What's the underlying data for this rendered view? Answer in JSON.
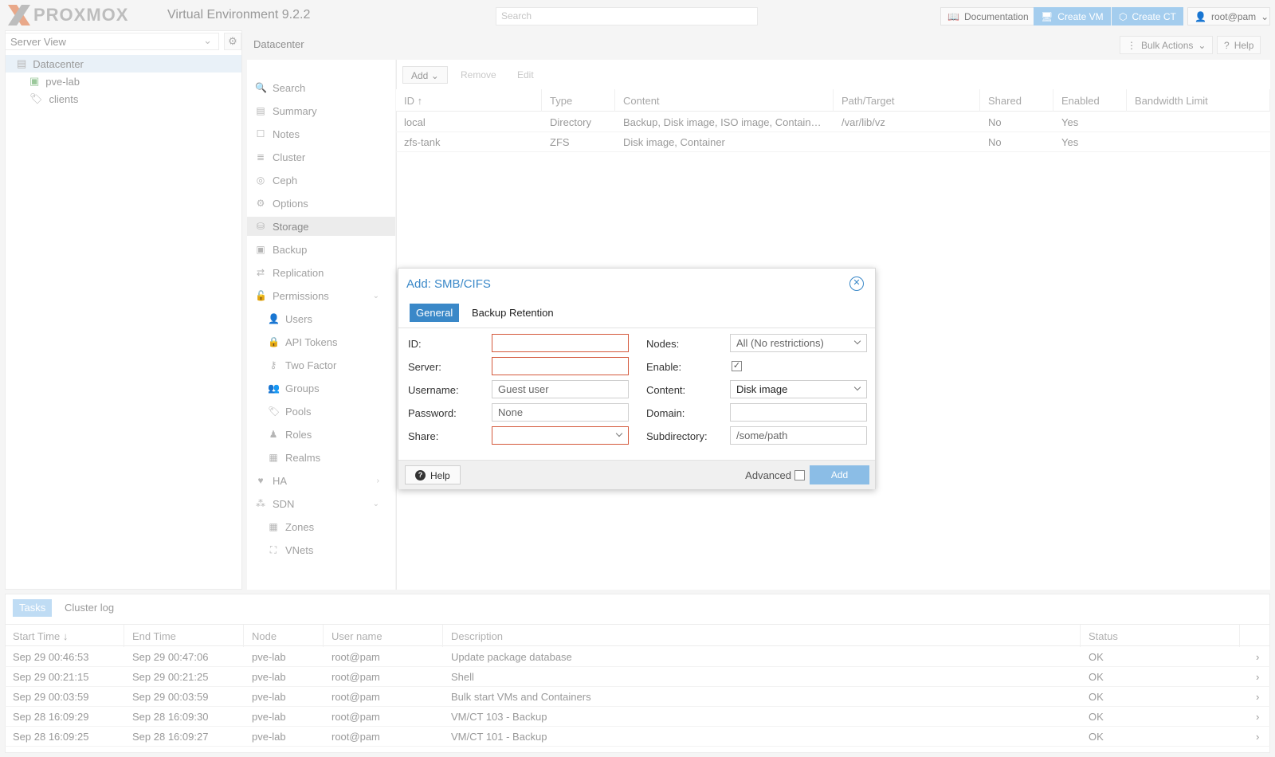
{
  "app": {
    "brand": "PROXMOX",
    "version_label": "Virtual Environment 9.2.2",
    "search_placeholder": "Search",
    "buttons": {
      "documentation": "Documentation",
      "create_vm": "Create VM",
      "create_ct": "Create CT",
      "user": "root@pam"
    }
  },
  "tree": {
    "view_label": "Server View",
    "items": [
      {
        "label": "Datacenter",
        "icon": "datacenter-icon"
      },
      {
        "label": "pve-lab",
        "icon": "node-icon"
      },
      {
        "label": "clients",
        "icon": "tags-icon"
      }
    ]
  },
  "breadcrumb": "Datacenter",
  "header_actions": {
    "bulk": "Bulk Actions",
    "help": "Help"
  },
  "nav": [
    {
      "label": "Search",
      "icon": "search-icon"
    },
    {
      "label": "Summary",
      "icon": "book-icon"
    },
    {
      "label": "Notes",
      "icon": "notes-icon"
    },
    {
      "label": "Cluster",
      "icon": "cluster-icon"
    },
    {
      "label": "Ceph",
      "icon": "ceph-icon"
    },
    {
      "label": "Options",
      "icon": "gear-icon"
    },
    {
      "label": "Storage",
      "icon": "database-icon"
    },
    {
      "label": "Backup",
      "icon": "floppy-icon"
    },
    {
      "label": "Replication",
      "icon": "replication-icon"
    },
    {
      "label": "Permissions",
      "icon": "unlock-icon"
    },
    {
      "label": "Users",
      "icon": "user-icon"
    },
    {
      "label": "API Tokens",
      "icon": "token-icon"
    },
    {
      "label": "Two Factor",
      "icon": "key-icon"
    },
    {
      "label": "Groups",
      "icon": "users-icon"
    },
    {
      "label": "Pools",
      "icon": "tags-icon"
    },
    {
      "label": "Roles",
      "icon": "male-icon"
    },
    {
      "label": "Realms",
      "icon": "realm-icon"
    },
    {
      "label": "HA",
      "icon": "heartbeat-icon"
    },
    {
      "label": "SDN",
      "icon": "sdn-icon"
    },
    {
      "label": "Zones",
      "icon": "grid-icon"
    },
    {
      "label": "VNets",
      "icon": "network-icon"
    }
  ],
  "storage": {
    "buttons": {
      "add": "Add",
      "remove": "Remove",
      "edit": "Edit"
    },
    "columns": [
      "ID",
      "Type",
      "Content",
      "Path/Target",
      "Shared",
      "Enabled",
      "Bandwidth Limit"
    ],
    "rows": [
      [
        "local",
        "Directory",
        "Backup, Disk image, ISO image, Contain…",
        "/var/lib/vz",
        "No",
        "Yes",
        ""
      ],
      [
        "zfs-tank",
        "ZFS",
        "Disk image, Container",
        "",
        "No",
        "Yes",
        ""
      ]
    ]
  },
  "tasks": {
    "tabs": [
      "Tasks",
      "Cluster log"
    ],
    "columns": [
      "Start Time",
      "End Time",
      "Node",
      "User name",
      "Description",
      "Status"
    ],
    "rows": [
      [
        "Sep 29 00:46:53",
        "Sep 29 00:47:06",
        "pve-lab",
        "root@pam",
        "Update package database",
        "OK"
      ],
      [
        "Sep 29 00:21:15",
        "Sep 29 00:21:25",
        "pve-lab",
        "root@pam",
        "Shell",
        "OK"
      ],
      [
        "Sep 29 00:03:59",
        "Sep 29 00:03:59",
        "pve-lab",
        "root@pam",
        "Bulk start VMs and Containers",
        "OK"
      ],
      [
        "Sep 28 16:09:29",
        "Sep 28 16:09:30",
        "pve-lab",
        "root@pam",
        "VM/CT 103 - Backup",
        "OK"
      ],
      [
        "Sep 28 16:09:25",
        "Sep 28 16:09:27",
        "pve-lab",
        "root@pam",
        "VM/CT 101 - Backup",
        "OK"
      ]
    ]
  },
  "dialog": {
    "title": "Add: SMB/CIFS",
    "tabs": [
      "General",
      "Backup Retention"
    ],
    "left_fields": [
      {
        "label": "ID:",
        "value": "",
        "placeholder": ""
      },
      {
        "label": "Server:",
        "value": "",
        "placeholder": ""
      },
      {
        "label": "Username:",
        "value": "",
        "placeholder": "Guest user"
      },
      {
        "label": "Password:",
        "value": "",
        "placeholder": "None"
      },
      {
        "label": "Share:",
        "value": "",
        "placeholder": ""
      }
    ],
    "right_fields": {
      "nodes_label": "Nodes:",
      "nodes_value": "All (No restrictions)",
      "enable_label": "Enable:",
      "enable_checked": true,
      "content_label": "Content:",
      "content_value": "Disk image",
      "domain_label": "Domain:",
      "domain_value": "",
      "subdir_label": "Subdirectory:",
      "subdir_placeholder": "/some/path"
    },
    "footer": {
      "help": "Help",
      "advanced": "Advanced",
      "add": "Add"
    }
  },
  "colors": {
    "accent": "#3a88c8",
    "error_border": "#d4583b",
    "tab_active": "#3a88c8"
  }
}
